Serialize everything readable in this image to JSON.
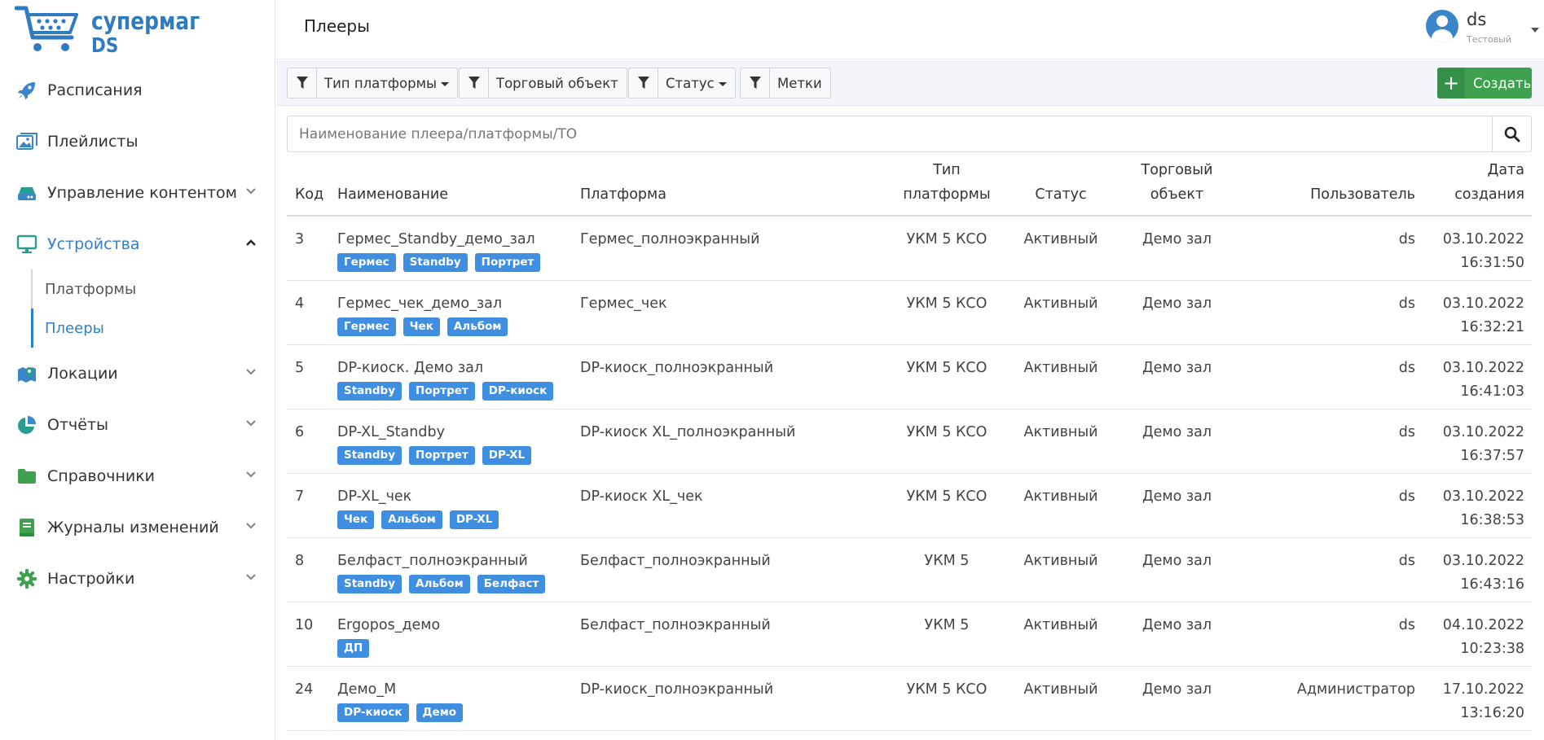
{
  "app": {
    "logo_line1": "супермаг",
    "logo_line2": "DS"
  },
  "sidebar": {
    "items": [
      {
        "label": "Расписания",
        "icon": "rocket-icon"
      },
      {
        "label": "Плейлисты",
        "icon": "images-icon"
      },
      {
        "label": "Управление контентом",
        "icon": "drive-icon"
      },
      {
        "label": "Устройства",
        "icon": "monitor-icon"
      },
      {
        "label": "Локации",
        "icon": "map-icon"
      },
      {
        "label": "Отчёты",
        "icon": "pie-chart-icon"
      },
      {
        "label": "Справочники",
        "icon": "folder-icon"
      },
      {
        "label": "Журналы изменений",
        "icon": "book-icon"
      },
      {
        "label": "Настройки",
        "icon": "gear-icon"
      }
    ],
    "subitems": [
      {
        "label": "Платформы"
      },
      {
        "label": "Плееры"
      }
    ]
  },
  "header": {
    "title": "Плееры",
    "user_name": "ds",
    "user_role": "Тестовый"
  },
  "filters": {
    "platform_type": "Тип платформы",
    "trade_object": "Торговый объект",
    "status": "Статус",
    "tags": "Метки",
    "create": "Создать"
  },
  "search": {
    "placeholder": "Наименование плеера/платформы/ТО"
  },
  "table": {
    "headers": {
      "code": "Код",
      "name": "Наименование",
      "platform": "Платформа",
      "ptype1": "Тип",
      "ptype2": "платформы",
      "status": "Статус",
      "to1": "Торговый",
      "to2": "объект",
      "user": "Пользователь",
      "date1": "Дата",
      "date2": "создания"
    },
    "rows": [
      {
        "code": "3",
        "name": "Гермес_Standby_демо_зал",
        "tags": [
          "Гермес",
          "Standby",
          "Портрет"
        ],
        "platform": "Гермес_полноэкранный",
        "ptype": "УКМ 5 КСО",
        "status": "Активный",
        "to": "Демо зал",
        "user": "ds",
        "date": "03.10.2022",
        "time": "16:31:50"
      },
      {
        "code": "4",
        "name": "Гермес_чек_демо_зал",
        "tags": [
          "Гермес",
          "Чек",
          "Альбом"
        ],
        "platform": "Гермес_чек",
        "ptype": "УКМ 5 КСО",
        "status": "Активный",
        "to": "Демо зал",
        "user": "ds",
        "date": "03.10.2022",
        "time": "16:32:21"
      },
      {
        "code": "5",
        "name": "DP-киоск. Демо зал",
        "tags": [
          "Standby",
          "Портрет",
          "DP-киоск"
        ],
        "platform": "DP-киоск_полноэкранный",
        "ptype": "УКМ 5 КСО",
        "status": "Активный",
        "to": "Демо зал",
        "user": "ds",
        "date": "03.10.2022",
        "time": "16:41:03"
      },
      {
        "code": "6",
        "name": "DP-XL_Standby",
        "tags": [
          "Standby",
          "Портрет",
          "DP-XL"
        ],
        "platform": "DP-киоск XL_полноэкранный",
        "ptype": "УКМ 5 КСО",
        "status": "Активный",
        "to": "Демо зал",
        "user": "ds",
        "date": "03.10.2022",
        "time": "16:37:57"
      },
      {
        "code": "7",
        "name": "DP-XL_чек",
        "tags": [
          "Чек",
          "Альбом",
          "DP-XL"
        ],
        "platform": "DP-киоск XL_чек",
        "ptype": "УКМ 5 КСО",
        "status": "Активный",
        "to": "Демо зал",
        "user": "ds",
        "date": "03.10.2022",
        "time": "16:38:53"
      },
      {
        "code": "8",
        "name": "Белфаст_полноэкранный",
        "tags": [
          "Standby",
          "Альбом",
          "Белфаст"
        ],
        "platform": "Белфаст_полноэкранный",
        "ptype": "УКМ 5",
        "status": "Активный",
        "to": "Демо зал",
        "user": "ds",
        "date": "03.10.2022",
        "time": "16:43:16"
      },
      {
        "code": "10",
        "name": "Ergopos_демо",
        "tags": [
          "ДП"
        ],
        "platform": "Белфаст_полноэкранный",
        "ptype": "УКМ 5",
        "status": "Активный",
        "to": "Демо зал",
        "user": "ds",
        "date": "04.10.2022",
        "time": "10:23:38"
      },
      {
        "code": "24",
        "name": "Демо_М",
        "tags": [
          "DP-киоск",
          "Демо"
        ],
        "platform": "DP-киоск_полноэкранный",
        "ptype": "УКМ 5 КСО",
        "status": "Активный",
        "to": "Демо зал",
        "user": "Администратор",
        "date": "17.10.2022",
        "time": "13:16:20"
      }
    ]
  },
  "colors": {
    "brand_blue": "#2f7bbf",
    "active_blue": "#2f80c8",
    "icon_blue": "#3a86c9",
    "icon_teal": "#2a9d8f",
    "icon_green": "#3fa14f",
    "tag_blue": "#3f8ee0",
    "create_green": "#3fa14f"
  }
}
